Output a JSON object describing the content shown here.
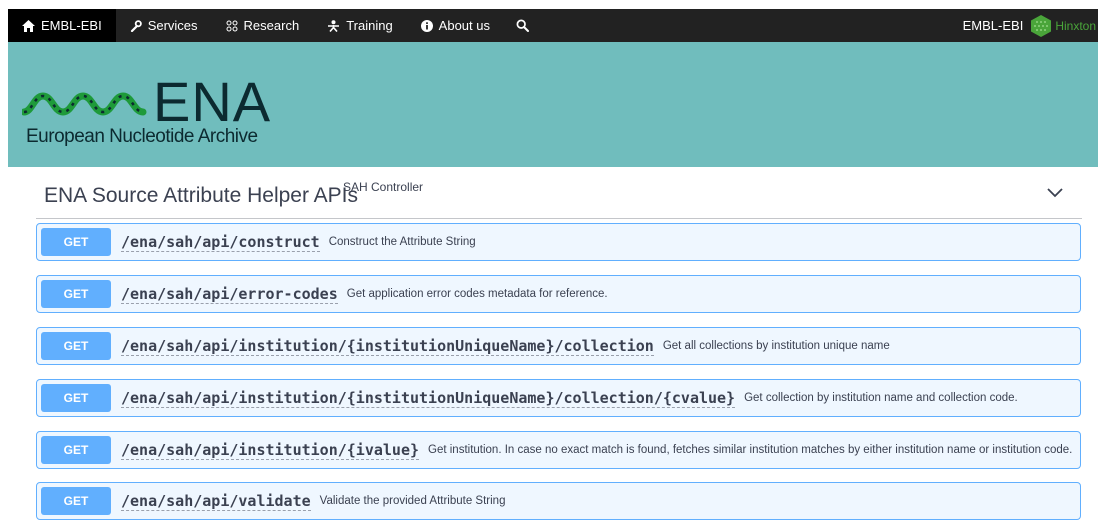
{
  "topnav": {
    "items": [
      {
        "label": "EMBL-EBI",
        "icon": "home-icon"
      },
      {
        "label": "Services",
        "icon": "wrench-icon"
      },
      {
        "label": "Research",
        "icon": "research-icon"
      },
      {
        "label": "Training",
        "icon": "training-icon"
      },
      {
        "label": "About us",
        "icon": "info-icon"
      }
    ],
    "search_icon": "search-icon",
    "right_link": "EMBL-EBI",
    "location": "Hinxton"
  },
  "banner": {
    "acronym": "ENA",
    "subtitle": "European Nucleotide Archive",
    "color": "#70bdbd"
  },
  "section": {
    "title": "ENA Source Attribute Helper APIs",
    "description": "SAH Controller"
  },
  "operations": [
    {
      "method": "GET",
      "path": "/ena/sah/api/construct",
      "summary": "Construct the Attribute String"
    },
    {
      "method": "GET",
      "path": "/ena/sah/api/error-codes",
      "summary": "Get application error codes metadata for reference."
    },
    {
      "method": "GET",
      "path": "/ena/sah/api/institution/{institutionUniqueName}/collection",
      "summary": "Get all collections by institution unique name"
    },
    {
      "method": "GET",
      "path": "/ena/sah/api/institution/{institutionUniqueName}/collection/{cvalue}",
      "summary": "Get collection by institution name and collection code."
    },
    {
      "method": "GET",
      "path": "/ena/sah/api/institution/{ivalue}",
      "summary": "Get institution. In case no exact match is found, fetches similar institution matches by either institution name or institution code."
    },
    {
      "method": "GET",
      "path": "/ena/sah/api/validate",
      "summary": "Validate the provided Attribute String"
    }
  ],
  "colors": {
    "get_method": "#61affe",
    "topbar": "#222222"
  }
}
